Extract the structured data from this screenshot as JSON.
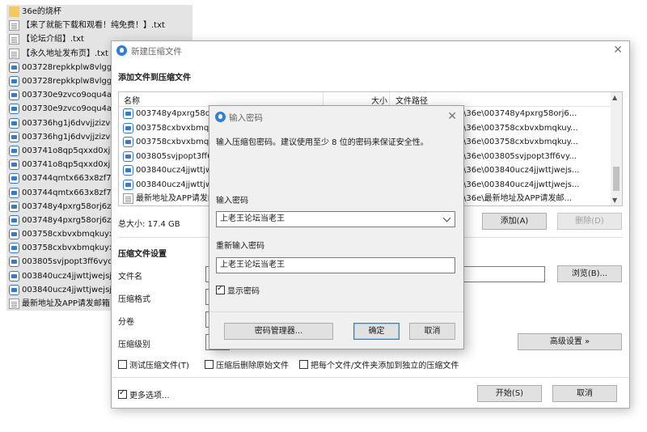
{
  "background_files": [
    {
      "icon": "folder-icon",
      "name": "36e的烧杯"
    },
    {
      "icon": "txt-file-icon",
      "name": "【来了就能下载和观看！纯免费！】.txt"
    },
    {
      "icon": "txt-file-icon",
      "name": "【论坛介绍】.txt"
    },
    {
      "icon": "txt-file-icon",
      "name": "【永久地址发布页】.txt"
    },
    {
      "icon": "archive-icon",
      "name": "003728repkkplw8vlggq"
    },
    {
      "icon": "archive-icon",
      "name": "003728repkkplw8vlggq"
    },
    {
      "icon": "archive-icon",
      "name": "003730e9zvco9oqu4a4"
    },
    {
      "icon": "archive-icon",
      "name": "003730e9zvco9oqu4a4"
    },
    {
      "icon": "archive-icon",
      "name": "003736hg1j6dvvjjzizvd"
    },
    {
      "icon": "archive-icon",
      "name": "003736hg1j6dvvjjzizvd"
    },
    {
      "icon": "archive-icon",
      "name": "003741o8qp5qxxd0xj7"
    },
    {
      "icon": "archive-icon",
      "name": "003741o8qp5qxxd0xj7"
    },
    {
      "icon": "archive-icon",
      "name": "003744qmtx663x8zf7m"
    },
    {
      "icon": "archive-icon",
      "name": "003744qmtx663x8zf7m"
    },
    {
      "icon": "archive-icon",
      "name": "003748y4pxrg58orj6z"
    },
    {
      "icon": "archive-icon",
      "name": "003748y4pxrg58orj6z"
    },
    {
      "icon": "archive-icon",
      "name": "003758cxbvxbmqkuyxu"
    },
    {
      "icon": "archive-icon",
      "name": "003758cxbvxbmqkuyxu"
    },
    {
      "icon": "archive-icon",
      "name": "003805svjpopt3ff6vyq"
    },
    {
      "icon": "archive-icon",
      "name": "003840ucz4jjwttjwejsje."
    },
    {
      "icon": "archive-icon",
      "name": "003840ucz4jjwttjwejsje."
    },
    {
      "icon": "txt-file-icon",
      "name": "最新地址及APP请发邮箱"
    }
  ],
  "main_dialog": {
    "title": "新建压缩文件",
    "add_section_title": "添加文件到压缩文件",
    "columns": {
      "name": "名称",
      "size": "大小",
      "path": "文件路径"
    },
    "rows": [
      {
        "icon": "archive-icon",
        "name": "003748y4pxrg58orj6",
        "path": "\\36e\\003748y4pxrg58orj6..."
      },
      {
        "icon": "archive-icon",
        "name": "003758cxbvxbmqku",
        "path": "\\36e\\003758cxbvxbmqkuy..."
      },
      {
        "icon": "archive-icon",
        "name": "003758cxbvxbmqku",
        "path": "\\36e\\003758cxbvxbmqkuy..."
      },
      {
        "icon": "archive-icon",
        "name": "003805svjpopt3ff6v",
        "path": "\\36e\\003805svjpopt3ff6vy..."
      },
      {
        "icon": "archive-icon",
        "name": "003840ucz4jjwttjwej",
        "path": "\\36e\\003840ucz4jjwttjwejs..."
      },
      {
        "icon": "archive-icon",
        "name": "003840ucz4jjwttjwej",
        "path": "\\36e\\003840ucz4jjwttjwejs..."
      },
      {
        "icon": "txt-file-icon",
        "name": "最新地址及APP请发邮",
        "path": "\\36e\\最新地址及APP请发邮..."
      }
    ],
    "total_size": "总大小: 17.4 GB",
    "add_button": "添加(A)",
    "delete_button": "删除(D)",
    "settings_title": "压缩文件设置",
    "filename_label": "文件名",
    "format_label": "压缩格式",
    "split_label": "分卷",
    "level_label": "压缩级别",
    "browse_button": "浏览(B)...",
    "advanced_button": "高级设置 »",
    "opt_test": "测试压缩文件(T)",
    "opt_delete": "压缩后删除原始文件",
    "opt_separate": "把每个文件/文件夹添加到独立的压缩文件",
    "more_options": "更多选项...",
    "start_button": "开始(S)",
    "cancel_button": "取消"
  },
  "password_dialog": {
    "title": "输入密码",
    "description": "输入压缩包密码。建议使用至少 8 位的密码来保证安全性。",
    "password_label": "输入密码",
    "password_value": "上老王论坛当老王",
    "reenter_label": "重新输入密码",
    "reenter_value": "上老王论坛当老王",
    "show_password_label": "显示密码",
    "show_password_checked": true,
    "manager_button": "密码管理器...",
    "ok_button": "确定",
    "cancel_button": "取消"
  }
}
